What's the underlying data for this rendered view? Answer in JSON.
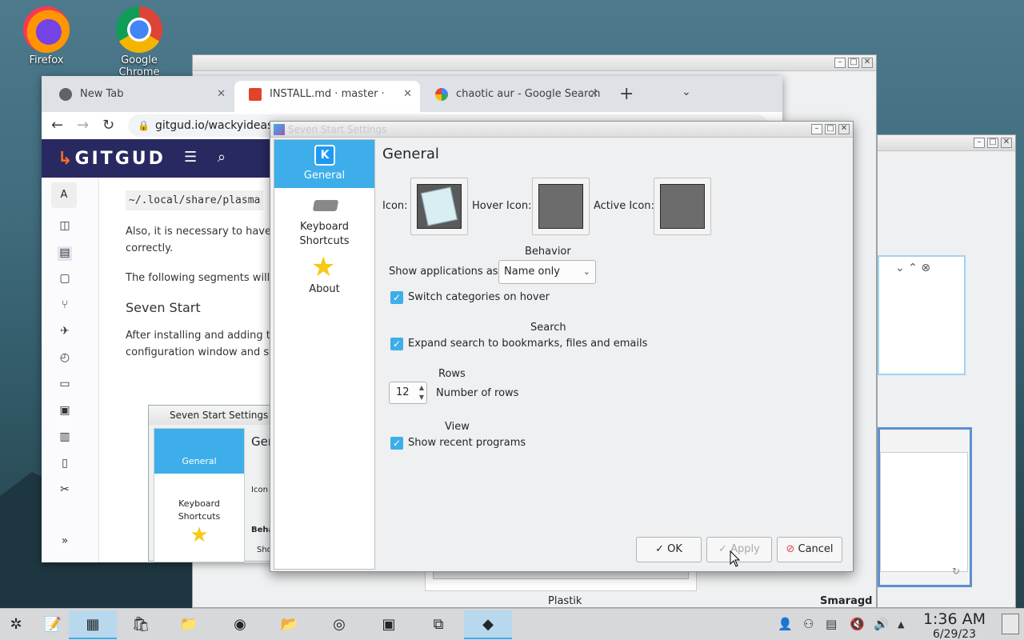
{
  "desktop": {
    "icons": [
      {
        "label": "Firefox"
      },
      {
        "label": "Google Chrome"
      }
    ]
  },
  "browser": {
    "tabs": [
      {
        "label": "New Tab"
      },
      {
        "label": "INSTALL.md · master · wacky"
      },
      {
        "label": "chaotic aur - Google Search"
      }
    ],
    "url": "gitgud.io/wackyideas",
    "site_logo": "GITGUD",
    "avatar_letter": "A",
    "code_path": "~/.local/share/plasma",
    "paragraphs": [
      "Also, it is necessary to have th",
      "correctly.",
      "The following segments will e"
    ],
    "section_heading": "Seven Start",
    "section_text_1": "After installing and adding th",
    "section_text_2": "configuration window and se"
  },
  "mini_dialog": {
    "title": "Seven Start Settings",
    "general": "General",
    "keyboard": "Keyboard",
    "shortcuts": "Shortcuts",
    "heading_frag": "Gen",
    "icon_frag": "Icon",
    "behavior_frag": "Beha",
    "show_frag": "Sho"
  },
  "dialog": {
    "title": "Seven Start Settings",
    "sidebar": [
      {
        "label": "General",
        "icon": "kde-icon"
      },
      {
        "label": "Keyboard Shortcuts",
        "icon": "keyboard-icon"
      },
      {
        "label": "About",
        "icon": "star-icon"
      }
    ],
    "heading": "General",
    "icon_label": "Icon:",
    "hover_icon_label": "Hover Icon:",
    "active_icon_label": "Active Icon:",
    "behavior_title": "Behavior",
    "show_apps_label": "Show applications as:",
    "show_apps_value": "Name only",
    "switch_categories_label": "Switch categories on hover",
    "search_title": "Search",
    "expand_search_label": "Expand search to bookmarks, files and emails",
    "rows_title": "Rows",
    "rows_value": "12",
    "rows_label": "Number of rows",
    "view_title": "View",
    "recent_label": "Show recent programs",
    "ok": "OK",
    "apply": "Apply",
    "cancel": "Cancel"
  },
  "bg_windows": {
    "theme1": "Plastik",
    "theme2": "Smaragd"
  },
  "taskbar": {
    "time": "1:36 AM",
    "date": "6/29/23"
  },
  "colors": {
    "accent": "#3daee9",
    "gitgud_header": "#292961"
  }
}
